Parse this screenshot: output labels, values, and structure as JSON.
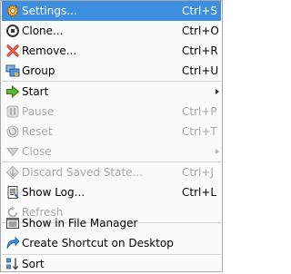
{
  "menu": {
    "settings": {
      "label": "Settings...",
      "shortcut": "Ctrl+S",
      "icon": "gear-icon"
    },
    "clone": {
      "label": "Clone...",
      "shortcut": "Ctrl+O",
      "icon": "clone-icon"
    },
    "remove": {
      "label": "Remove...",
      "shortcut": "Ctrl+R",
      "icon": "remove-icon"
    },
    "group": {
      "label": "Group",
      "shortcut": "Ctrl+U",
      "icon": "group-icon"
    },
    "start": {
      "label": "Start",
      "icon": "start-arrow-icon"
    },
    "pause": {
      "label": "Pause",
      "shortcut": "Ctrl+P",
      "icon": "pause-icon"
    },
    "reset": {
      "label": "Reset",
      "shortcut": "Ctrl+T",
      "icon": "reset-icon"
    },
    "close": {
      "label": "Close",
      "icon": "close-icon"
    },
    "discard": {
      "label": "Discard Saved State...",
      "shortcut": "Ctrl+J",
      "icon": "discard-icon"
    },
    "show_log": {
      "label": "Show Log...",
      "shortcut": "Ctrl+L",
      "icon": "log-icon"
    },
    "refresh": {
      "label": "Refresh",
      "icon": "refresh-icon"
    },
    "file_manager": {
      "label": "Show in File Manager",
      "icon": "file-manager-icon"
    },
    "shortcut_desktop": {
      "label": "Create Shortcut on Desktop",
      "icon": "desktop-shortcut-icon"
    },
    "sort": {
      "label": "Sort",
      "icon": "sort-icon"
    }
  },
  "colors": {
    "highlight": "#3d8ede",
    "disabled_text": "#a8a8a8",
    "background": "#fbfbfb"
  }
}
